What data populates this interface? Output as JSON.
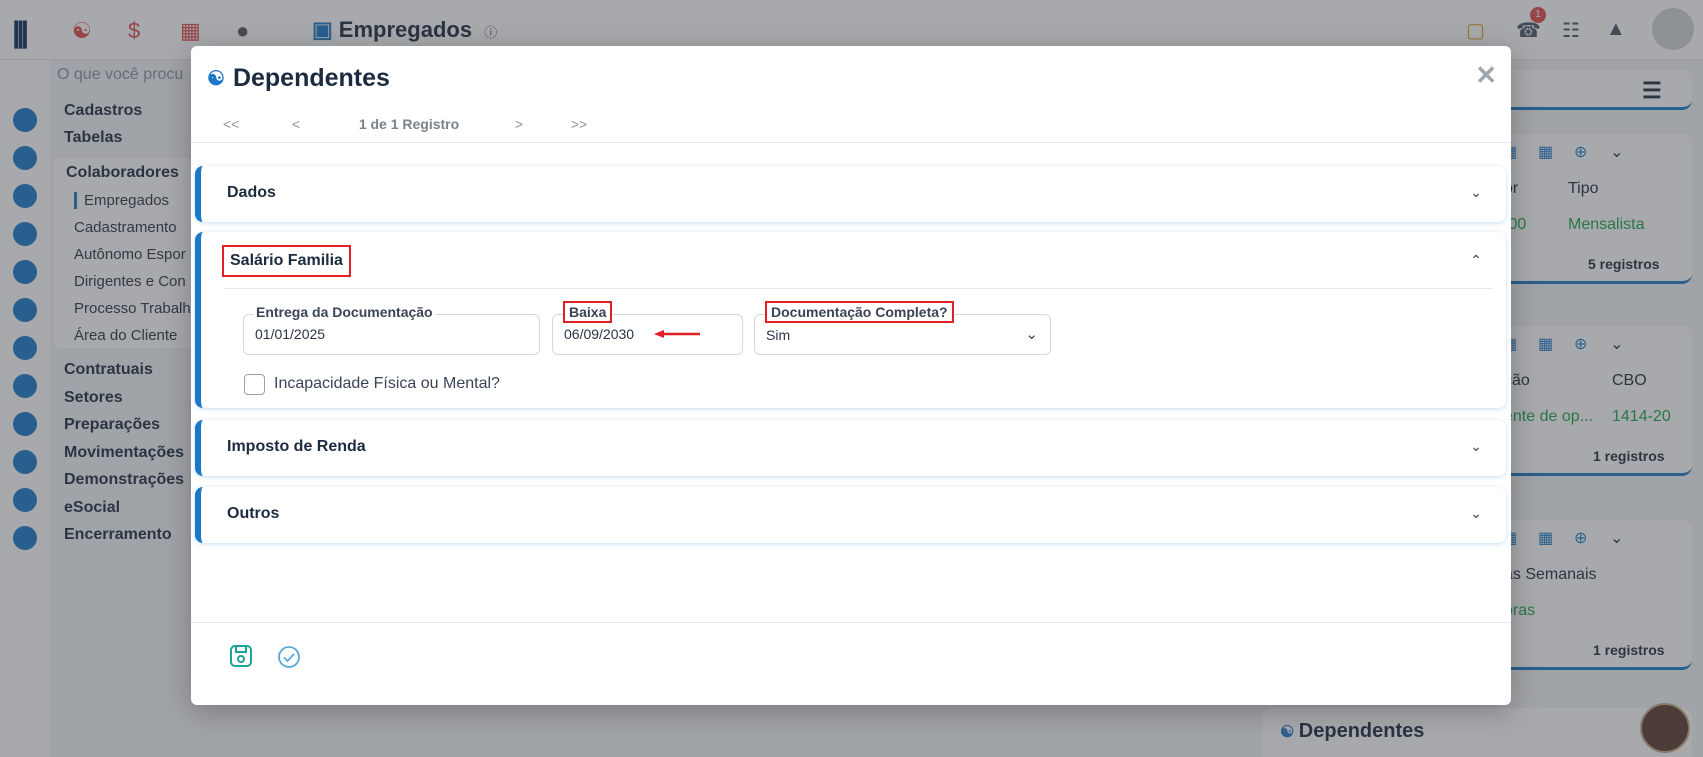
{
  "background_app": {
    "title": "Empregados",
    "notification_count": "1",
    "search_placeholder": "O que você procu",
    "menu": [
      "Cadastros",
      "Tabelas",
      "Contratuais",
      "Setores",
      "Preparações",
      "Movimentações",
      "Demonstrações",
      "eSocial",
      "Encerramento"
    ],
    "submenu_header": "Colaboradores",
    "submenu": [
      "Empregados",
      "Cadastramento",
      "Autônomo Espor",
      "Dirigentes e Con",
      "Processo Trabalh",
      "Área do Cliente"
    ],
    "card1": {
      "col_a": "or",
      "col_b": "Tipo",
      "val_a": ",00",
      "val_b": "Mensalista",
      "count": "5 registros"
    },
    "card2": {
      "col_a": "ção",
      "col_b": "CBO",
      "val_a": "ente de op...",
      "val_b": "1414-20",
      "count": "1 registros"
    },
    "card3": {
      "col_a": "as Semanais",
      "val_a": "oras",
      "count": "1 registros"
    },
    "card4_title": "Dependentes"
  },
  "modal": {
    "title": "Dependentes",
    "close_label": "✕",
    "pager": {
      "first": "<<",
      "prev": "<",
      "info": "1 de 1 Registro",
      "next": ">",
      "last": ">>"
    },
    "sections": {
      "dados": "Dados",
      "salario_familia": "Salário Familia",
      "imposto": "Imposto de Renda",
      "outros": "Outros"
    },
    "fields": {
      "entrega_label": "Entrega da Documentação",
      "entrega_value": "01/01/2025",
      "baixa_label": "Baixa",
      "baixa_value": "06/09/2030",
      "doc_label": "Documentação Completa?",
      "doc_value": "Sim",
      "incapacidade_label": "Incapacidade Física ou Mental?"
    }
  },
  "colors": {
    "accent": "#1b78c8",
    "highlight_red": "#e01f26",
    "success_green": "#1ea34a"
  }
}
